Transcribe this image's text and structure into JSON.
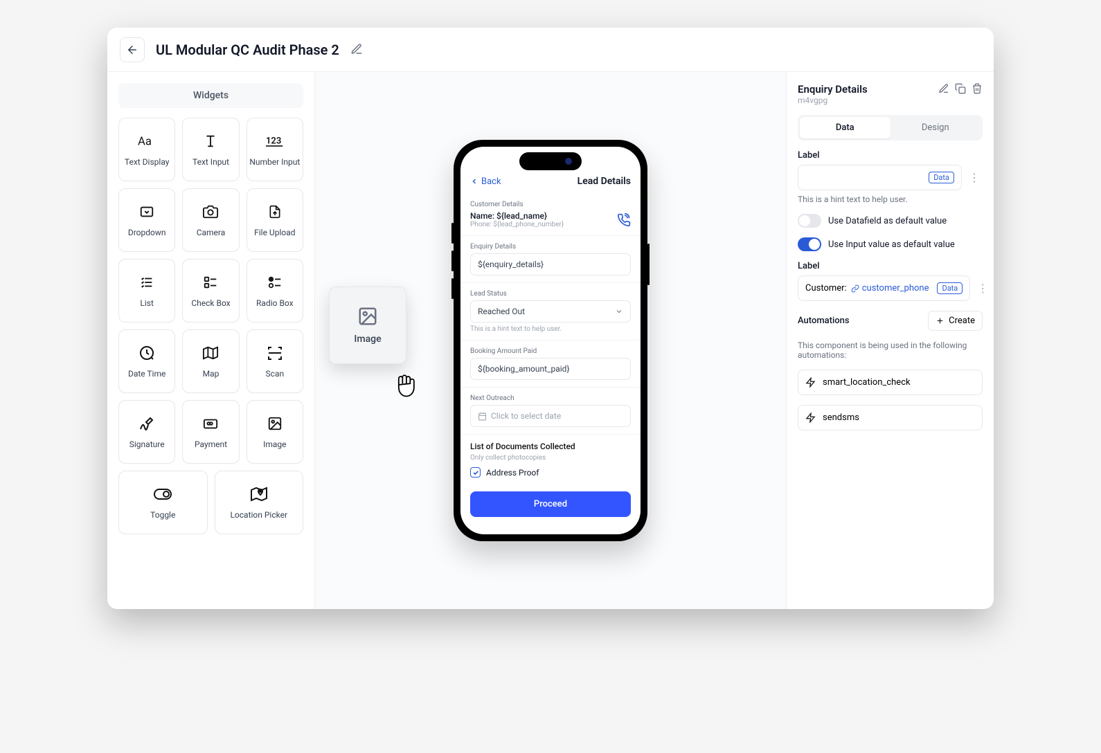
{
  "header": {
    "title": "UL Modular QC Audit Phase 2"
  },
  "sidebar": {
    "section_label": "Widgets",
    "widgets": [
      {
        "label": "Text Display"
      },
      {
        "label": "Text Input"
      },
      {
        "label": "Number Input"
      },
      {
        "label": "Dropdown"
      },
      {
        "label": "Camera"
      },
      {
        "label": "File Upload"
      },
      {
        "label": "List"
      },
      {
        "label": "Check Box"
      },
      {
        "label": "Radio Box"
      },
      {
        "label": "Date Time"
      },
      {
        "label": "Map"
      },
      {
        "label": "Scan"
      },
      {
        "label": "Signature"
      },
      {
        "label": "Payment"
      },
      {
        "label": "Image"
      }
    ],
    "widgets_bottom": [
      {
        "label": "Toggle"
      },
      {
        "label": "Location Picker"
      }
    ]
  },
  "drag_ghost": {
    "label": "Image"
  },
  "phone": {
    "back_label": "Back",
    "screen_title": "Lead Details",
    "customer": {
      "section": "Customer Details",
      "name": "Name: ${lead_name}",
      "phone": "Phone: ${lead_phone_number}"
    },
    "enquiry": {
      "section": "Enquiry Details",
      "value": "${enquiry_details}"
    },
    "lead_status": {
      "section": "Lead Status",
      "value": "Reached Out",
      "hint": "This is a hint text to help user."
    },
    "booking": {
      "section": "Booking Amount Paid",
      "value": "${booking_amount_paid}"
    },
    "outreach": {
      "section": "Next Outreach",
      "placeholder": "Click to select date"
    },
    "docs": {
      "section": "List of Documents Collected",
      "hint": "Only collect photocopies",
      "option": "Address Proof"
    },
    "proceed": "Proceed"
  },
  "props": {
    "title": "Enquiry Details",
    "id": "m4vgpg",
    "tabs": {
      "data": "Data",
      "design": "Design"
    },
    "label_field": {
      "label": "Label",
      "badge": "Data",
      "hint": "This is a hint text to help user."
    },
    "toggle1": "Use Datafield as default value",
    "toggle2": "Use Input value as default value",
    "label2": {
      "label": "Label",
      "prefix": "Customer:",
      "tag": "customer_phone",
      "badge": "Data"
    },
    "automations": {
      "header": "Automations",
      "create": "Create",
      "desc": "This component is being used in the following automations:",
      "items": [
        "smart_location_check",
        "sendsms"
      ]
    }
  }
}
